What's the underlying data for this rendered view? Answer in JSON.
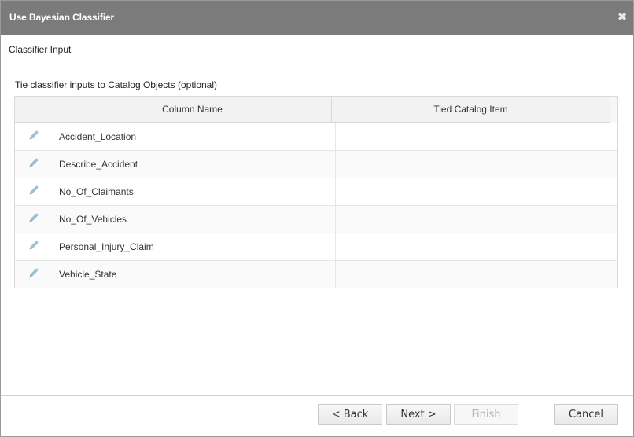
{
  "dialog": {
    "title": "Use Bayesian Classifier",
    "close_glyph": "✖"
  },
  "section": {
    "title": "Classifier Input",
    "instruction": "Tie classifier inputs to Catalog Objects (optional)"
  },
  "grid": {
    "columns": [
      "Column Name",
      "Tied Catalog Item"
    ],
    "rows": [
      {
        "column_name": "Accident_Location",
        "tied_item": "",
        "icon": "pencil-icon"
      },
      {
        "column_name": "Describe_Accident",
        "tied_item": "",
        "icon": "pencil-icon"
      },
      {
        "column_name": "No_Of_Claimants",
        "tied_item": "",
        "icon": "pencil-icon"
      },
      {
        "column_name": "No_Of_Vehicles",
        "tied_item": "",
        "icon": "pencil-icon"
      },
      {
        "column_name": "Personal_Injury_Claim",
        "tied_item": "",
        "icon": "pencil-icon"
      },
      {
        "column_name": "Vehicle_State",
        "tied_item": "",
        "icon": "pencil-icon"
      }
    ]
  },
  "footer": {
    "back_label": "< Back",
    "next_label": "Next >",
    "finish_label": "Finish",
    "cancel_label": "Cancel"
  },
  "colors": {
    "titlebar": "#7b7b7b",
    "pencil": "#9cc3d6",
    "disabled_text": "#b5b5b5"
  }
}
